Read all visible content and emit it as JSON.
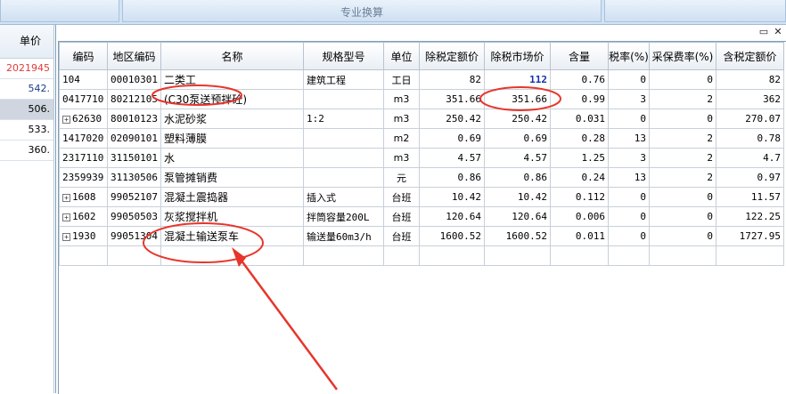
{
  "tabs": {
    "left": "",
    "middle": "专业换算",
    "right": ""
  },
  "left_column": {
    "header": "单价",
    "cells": [
      {
        "value": "2021945",
        "style": "red"
      },
      {
        "value": "542.",
        "style": "blue"
      },
      {
        "value": "506.",
        "style": "sel"
      },
      {
        "value": "533.",
        "style": ""
      },
      {
        "value": "360.",
        "style": ""
      }
    ]
  },
  "window_controls": {
    "restore": "▭",
    "close": "✕"
  },
  "table": {
    "headers": [
      "编码",
      "地区编码",
      "名称",
      "规格型号",
      "单位",
      "除税定额价",
      "除税市场价",
      "含量",
      "税率(%)",
      "采保费率(%)",
      "含税定额价"
    ],
    "rows": [
      {
        "expandable": false,
        "code": "104",
        "region": "00010301",
        "name": "二类工",
        "spec": "建筑工程",
        "unit": "工日",
        "base": "82",
        "market": "112",
        "market_bold": true,
        "qty": "0.76",
        "tax": "0",
        "fee": "0",
        "taxed": "82"
      },
      {
        "expandable": false,
        "code": "0417710",
        "region": "80212105",
        "name": "(C30泵送预拌砼)",
        "spec": "",
        "unit": "m3",
        "base": "351.66",
        "market": "351.66",
        "market_bold": false,
        "qty": "0.99",
        "tax": "3",
        "fee": "2",
        "taxed": "362"
      },
      {
        "expandable": true,
        "code": "62630",
        "region": "80010123",
        "name": "水泥砂浆",
        "spec": "1:2",
        "unit": "m3",
        "base": "250.42",
        "market": "250.42",
        "market_bold": false,
        "qty": "0.031",
        "tax": "0",
        "fee": "0",
        "taxed": "270.07"
      },
      {
        "expandable": false,
        "code": "1417020",
        "region": "02090101",
        "name": "塑料薄膜",
        "spec": "",
        "unit": "m2",
        "base": "0.69",
        "market": "0.69",
        "market_bold": false,
        "qty": "0.28",
        "tax": "13",
        "fee": "2",
        "taxed": "0.78"
      },
      {
        "expandable": false,
        "code": "2317110",
        "region": "31150101",
        "name": "水",
        "spec": "",
        "unit": "m3",
        "base": "4.57",
        "market": "4.57",
        "market_bold": false,
        "qty": "1.25",
        "tax": "3",
        "fee": "2",
        "taxed": "4.7"
      },
      {
        "expandable": false,
        "code": "2359939",
        "region": "31130506",
        "name": "泵管摊销费",
        "spec": "",
        "unit": "元",
        "base": "0.86",
        "market": "0.86",
        "market_bold": false,
        "qty": "0.24",
        "tax": "13",
        "fee": "2",
        "taxed": "0.97"
      },
      {
        "expandable": true,
        "code": "1608",
        "region": "99052107",
        "name": "混凝土震捣器",
        "spec": "插入式",
        "unit": "台班",
        "base": "10.42",
        "market": "10.42",
        "market_bold": false,
        "qty": "0.112",
        "tax": "0",
        "fee": "0",
        "taxed": "11.57"
      },
      {
        "expandable": true,
        "code": "1602",
        "region": "99050503",
        "name": "灰浆搅拌机",
        "spec": "拌筒容量200L",
        "unit": "台班",
        "base": "120.64",
        "market": "120.64",
        "market_bold": false,
        "qty": "0.006",
        "tax": "0",
        "fee": "0",
        "taxed": "122.25"
      },
      {
        "expandable": true,
        "code": "1930",
        "region": "99051304",
        "name": "混凝土输送泵车",
        "spec": "输送量60m3/h",
        "unit": "台班",
        "base": "1600.52",
        "market": "1600.52",
        "market_bold": false,
        "qty": "0.011",
        "tax": "0",
        "fee": "0",
        "taxed": "1727.95"
      }
    ]
  },
  "annotation_color": "#e8352b"
}
